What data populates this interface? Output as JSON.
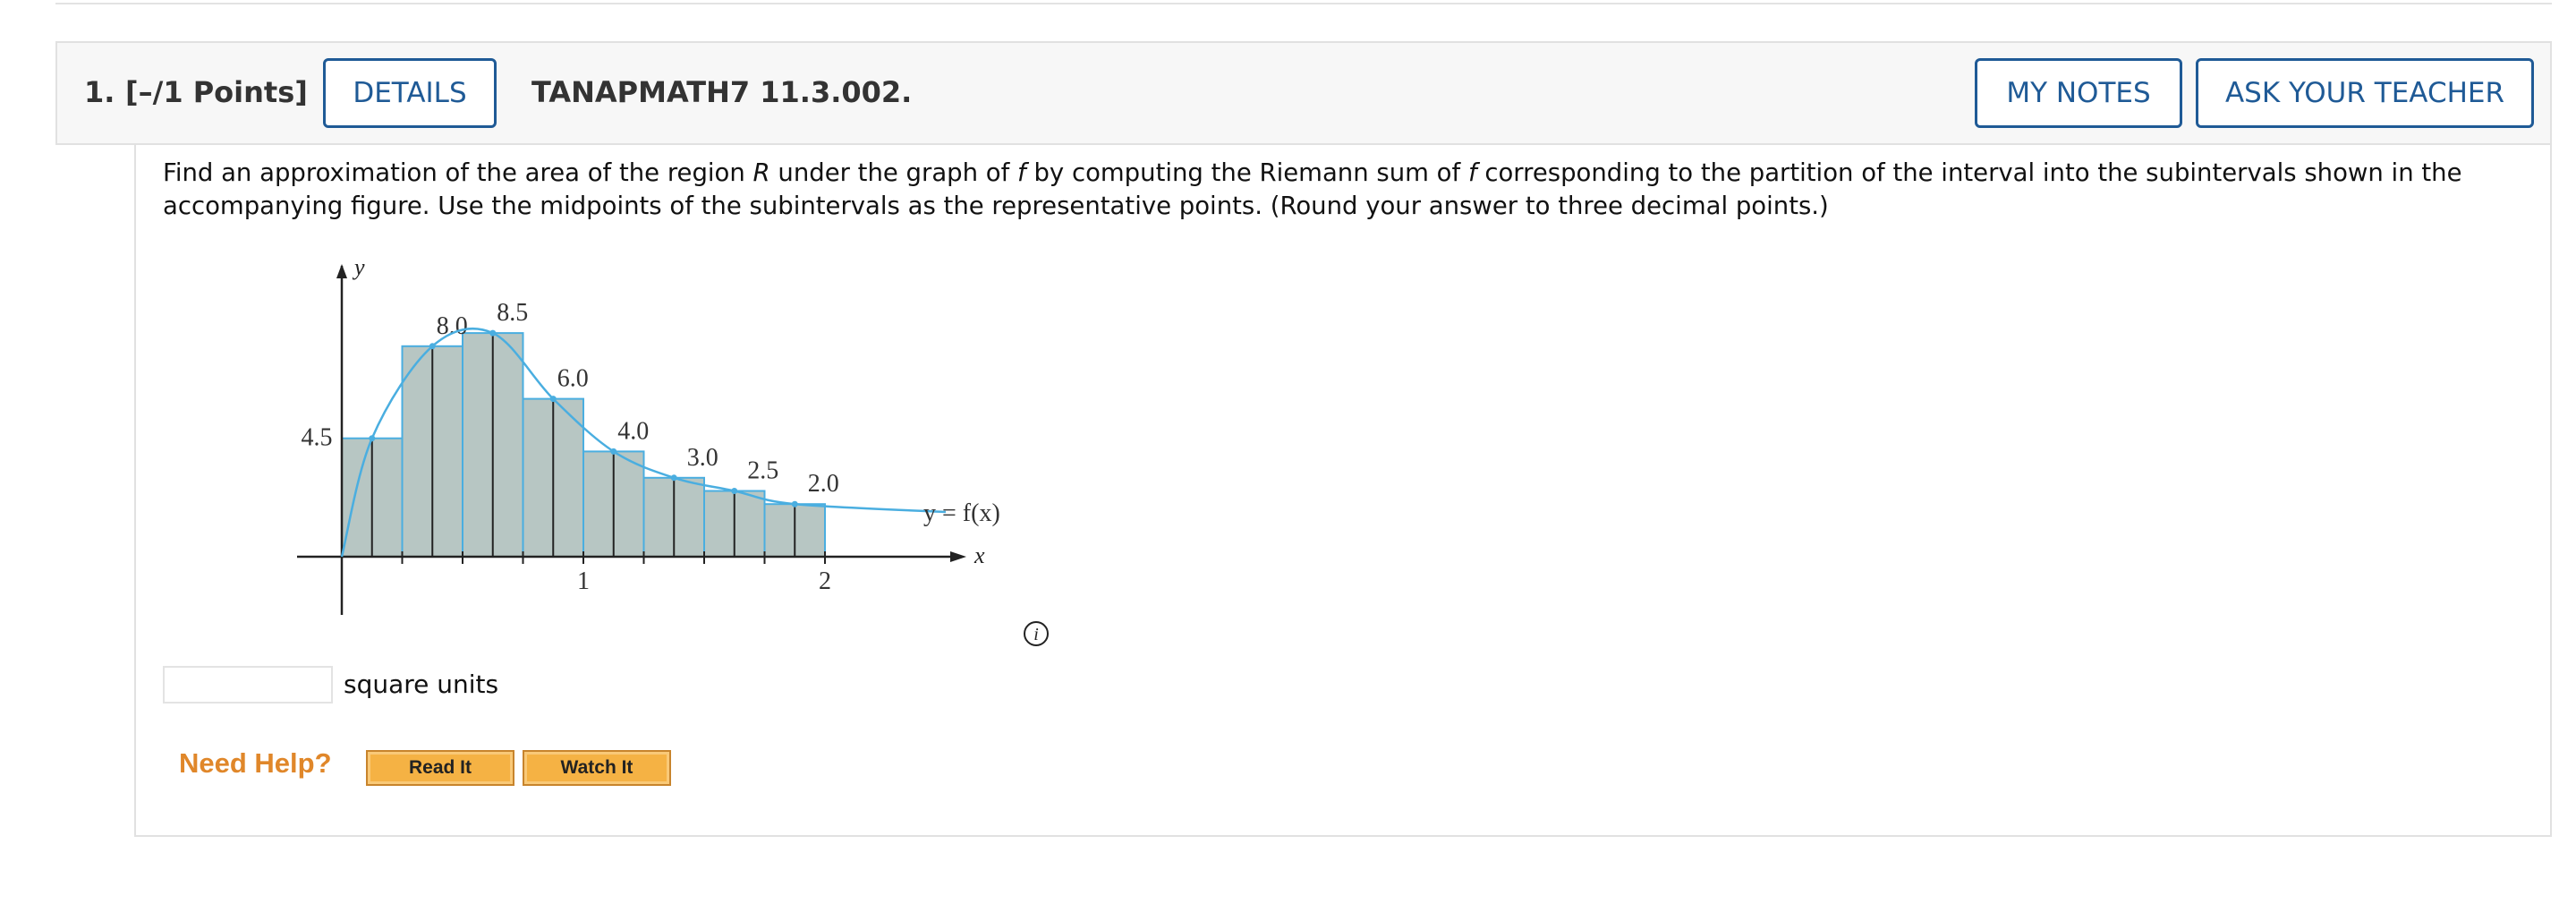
{
  "question": {
    "number": "1.",
    "points": "[–/1 Points]",
    "details_label": "DETAILS",
    "code": "TANAPMATH7 11.3.002.",
    "my_notes_label": "MY NOTES",
    "ask_teacher_label": "ASK YOUR TEACHER"
  },
  "prompt": {
    "p1": "Find an approximation of the area of the region ",
    "R": "R",
    "p2": " under the graph of ",
    "f1": "f",
    "p3": " by computing the Riemann sum of ",
    "f2": "f",
    "p4": " corresponding to the partition of the interval into the subintervals shown in the accompanying figure. Use the midpoints of the subintervals as the representative points. (Round your answer to three decimal points.)"
  },
  "figure": {
    "y_axis_label": "y",
    "x_axis_label": "x",
    "curve_label": "y = f(x)",
    "tick_1": "1",
    "tick_2": "2"
  },
  "chart_data": {
    "type": "bar",
    "x_intervals": [
      [
        0,
        0.25
      ],
      [
        0.25,
        0.5
      ],
      [
        0.5,
        0.75
      ],
      [
        0.75,
        1.0
      ],
      [
        1.0,
        1.25
      ],
      [
        1.25,
        1.5
      ],
      [
        1.5,
        1.75
      ],
      [
        1.75,
        2.0
      ]
    ],
    "values": [
      4.5,
      8.0,
      8.5,
      6.0,
      4.0,
      3.0,
      2.5,
      2.0
    ],
    "labels": [
      "4.5",
      "8.0",
      "8.5",
      "6.0",
      "4.0",
      "3.0",
      "2.5",
      "2.0"
    ],
    "xlim": [
      0,
      2.6
    ],
    "ylim": [
      0,
      9.5
    ],
    "x_ticks": [
      1,
      2
    ],
    "grid": false,
    "colors": {
      "bar_fill": "#b7c6c3",
      "curve": "#4aaee0"
    }
  },
  "answer": {
    "value": "",
    "units": "square units"
  },
  "help": {
    "title": "Need Help?",
    "read_it": "Read It",
    "watch_it": "Watch It"
  },
  "colors": {
    "accent": "#1f5a96",
    "help": "#e0872a",
    "help_button": "#f5b244"
  }
}
